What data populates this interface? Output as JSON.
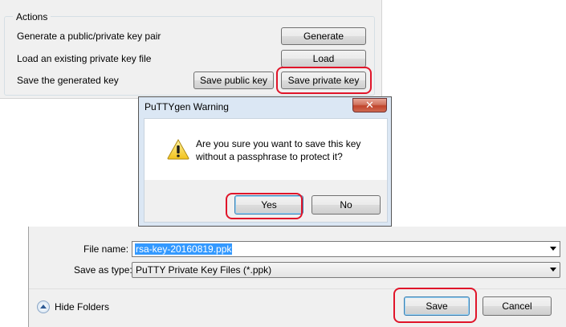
{
  "actions": {
    "title": "Actions",
    "rows": [
      {
        "label": "Generate a public/private key pair",
        "buttons": [
          "Generate"
        ]
      },
      {
        "label": "Load an existing private key file",
        "buttons": [
          "Load"
        ]
      },
      {
        "label": "Save the generated key",
        "buttons": [
          "Save public key",
          "Save private key"
        ]
      }
    ]
  },
  "warning_dialog": {
    "title": "PuTTYgen Warning",
    "close_glyph": "✕",
    "message_line1": "Are you sure you want to save this key",
    "message_line2": "without a passphrase to protect it?",
    "yes_label": "Yes",
    "no_label": "No",
    "icon": "warning-icon"
  },
  "save_dialog": {
    "file_name_label": "File name:",
    "file_name_value": "rsa-key-20160819.ppk",
    "save_as_type_label": "Save as type:",
    "save_as_type_value": "PuTTY Private Key Files (*.ppk)",
    "hide_folders_label": "Hide Folders",
    "save_label": "Save",
    "cancel_label": "Cancel"
  },
  "colors": {
    "highlight_ring": "#e0152a",
    "selection": "#3399ff"
  }
}
